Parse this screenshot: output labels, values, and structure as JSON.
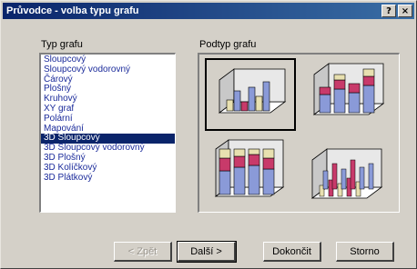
{
  "window": {
    "title": "Průvodce - volba typu grafu",
    "help_glyph": "?",
    "close_glyph": "×"
  },
  "chart_type": {
    "label": "Typ grafu",
    "items": [
      "Sloupcový",
      "Sloupcový vodorovný",
      "Čárový",
      "Plošný",
      "Kruhový",
      "XY graf",
      "Polární",
      "Mapování",
      "3D Sloupcový",
      "3D Sloupcový vodorovný",
      "3D Plošný",
      "3D Kolíčkový",
      "3D Plátkový"
    ],
    "selected": "3D Sloupcový"
  },
  "subtype": {
    "label": "Podtyp grafu",
    "options": [
      "3d-clustered-column-icon",
      "3d-stacked-column-icon",
      "3d-100-stacked-column-icon",
      "3d-column-icon"
    ],
    "selected_index": 0
  },
  "buttons": {
    "back": "< Zpět",
    "next": "Další >",
    "finish": "Dokončit",
    "cancel": "Storno"
  },
  "colors": {
    "accent_title": "#0a246a",
    "series_blue": "#8a9ad8",
    "series_red": "#c83a6a",
    "series_cream": "#e8e0b0"
  }
}
